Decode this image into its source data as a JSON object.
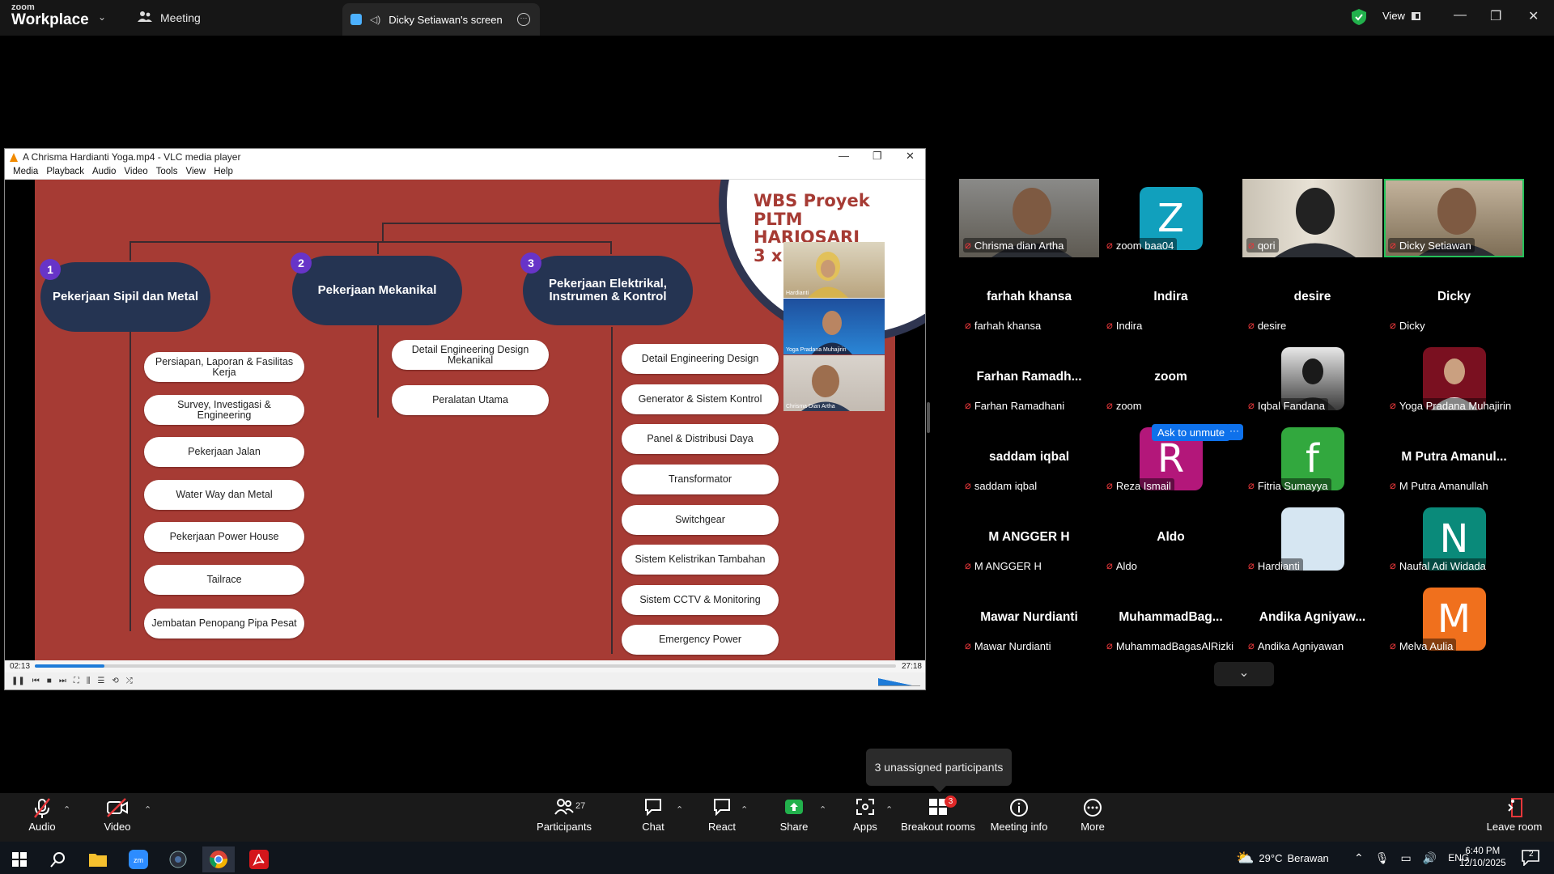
{
  "zoom": {
    "app_small": "zoom",
    "app_name": "Workplace",
    "meeting_label": "Meeting",
    "share_tab": "Dicky Setiawan's screen",
    "view_label": "View"
  },
  "vlc": {
    "title": "A Chrisma Hardianti Yoga.mp4 - VLC media player",
    "menu": [
      "Media",
      "Playback",
      "Audio",
      "Video",
      "Tools",
      "View",
      "Help"
    ],
    "time_elapsed": "02:13",
    "time_total": "27:18",
    "progress": 0.081
  },
  "slide": {
    "title_lines": [
      "WBS Proyek",
      "PLTM HARJOSARI",
      "3 x 3,3 MW"
    ],
    "categories": [
      {
        "num": "1",
        "title": "Pekerjaan Sipil dan Metal"
      },
      {
        "num": "2",
        "title": "Pekerjaan Mekanikal"
      },
      {
        "num": "3",
        "title": "Pekerjaan Elektrikal, Instrumen & Kontrol"
      }
    ],
    "sipil_items": [
      "Persiapan, Laporan & Fasilitas Kerja",
      "Survey, Investigasi & Engineering",
      "Pekerjaan Jalan",
      "Water Way dan Metal",
      "Pekerjaan Power House",
      "Tailrace",
      "Jembatan Penopang Pipa Pesat"
    ],
    "mekanikal_items": [
      "Detail Engineering Design Mekanikal",
      "Peralatan Utama"
    ],
    "elektrikal_items": [
      "Detail Engineering Design",
      "Generator & Sistem Kontrol",
      "Panel & Distribusi Daya",
      "Transformator",
      "Switchgear",
      "Sistem Kelistrikan Tambahan",
      "Sistem CCTV & Monitoring",
      "Emergency Power"
    ],
    "video_thumbs": [
      "Hardianti",
      "Yoga Pradana Muhajirin",
      "Chrisma Dian Artha"
    ]
  },
  "participants_gallery": [
    [
      {
        "label": "Chrisma dian Artha",
        "display": "",
        "avatar": "video"
      },
      {
        "label": "zoom baa04",
        "display": "",
        "avatar": "Z",
        "color": "#11a0bd"
      },
      {
        "label": "qori",
        "display": "",
        "avatar": "video"
      },
      {
        "label": "Dicky Setiawan",
        "display": "",
        "avatar": "video-active"
      }
    ],
    [
      {
        "label": "farhah khansa",
        "display": "farhah khansa"
      },
      {
        "label": "Indira",
        "display": "Indira"
      },
      {
        "label": "desire",
        "display": "desire"
      },
      {
        "label": "Dicky",
        "display": "Dicky"
      }
    ],
    [
      {
        "label": "Farhan Ramadhani",
        "display": "Farhan Ramadh..."
      },
      {
        "label": "zoom",
        "display": "zoom"
      },
      {
        "label": "Iqbal Fandana",
        "display": "",
        "avatar": "photo"
      },
      {
        "label": "Yoga Pradana Muhajirin",
        "display": "",
        "avatar": "photo2"
      }
    ],
    [
      {
        "label": "saddam iqbal",
        "display": "saddam iqbal"
      },
      {
        "label": "Reza Ismail",
        "display": "",
        "avatar": "R",
        "color": "#b3177a"
      },
      {
        "label": "Fitria Sumayya",
        "display": "",
        "avatar": "f",
        "color": "#32a83e"
      },
      {
        "label": "M Putra Amanullah",
        "display": "M Putra Amanul..."
      }
    ],
    [
      {
        "label": "M ANGGER H",
        "display": "M ANGGER H"
      },
      {
        "label": "Aldo",
        "display": "Aldo"
      },
      {
        "label": "Hardianti",
        "display": "",
        "avatar": " ",
        "color": "#d6e6f2"
      },
      {
        "label": "Naufal Adi Widada",
        "display": "",
        "avatar": "N",
        "color": "#0a8a7a"
      }
    ],
    [
      {
        "label": "Mawar Nurdianti",
        "display": "Mawar Nurdianti"
      },
      {
        "label": "MuhammadBagasAlRizki",
        "display": "MuhammadBag..."
      },
      {
        "label": "Andika Agniyawan",
        "display": "Andika Agniyaw..."
      },
      {
        "label": "Melva Aulia",
        "display": "",
        "avatar": "M",
        "color": "#f0701d"
      }
    ]
  ],
  "ask_to_unmute": "Ask to unmute",
  "unassigned_tooltip": "3 unassigned participants",
  "toolbar": {
    "audio": "Audio",
    "video": "Video",
    "participants": "Participants",
    "participants_count": "27",
    "chat": "Chat",
    "react": "React",
    "share": "Share",
    "apps": "Apps",
    "breakout": "Breakout rooms",
    "breakout_badge": "3",
    "meeting_info": "Meeting info",
    "more": "More",
    "leave": "Leave room"
  },
  "taskbar": {
    "weather_temp": "29°C",
    "weather_text": "Berawan",
    "lang": "ENG",
    "time": "6:40 PM",
    "date": "12/10/2025",
    "notif_count": "2"
  },
  "colors": {
    "slide_bg": "#a63b34",
    "category_fill": "#253452",
    "number_badge": "#6734c8",
    "zoom_blue": "#0e71eb",
    "mute_red": "#e6373a"
  }
}
